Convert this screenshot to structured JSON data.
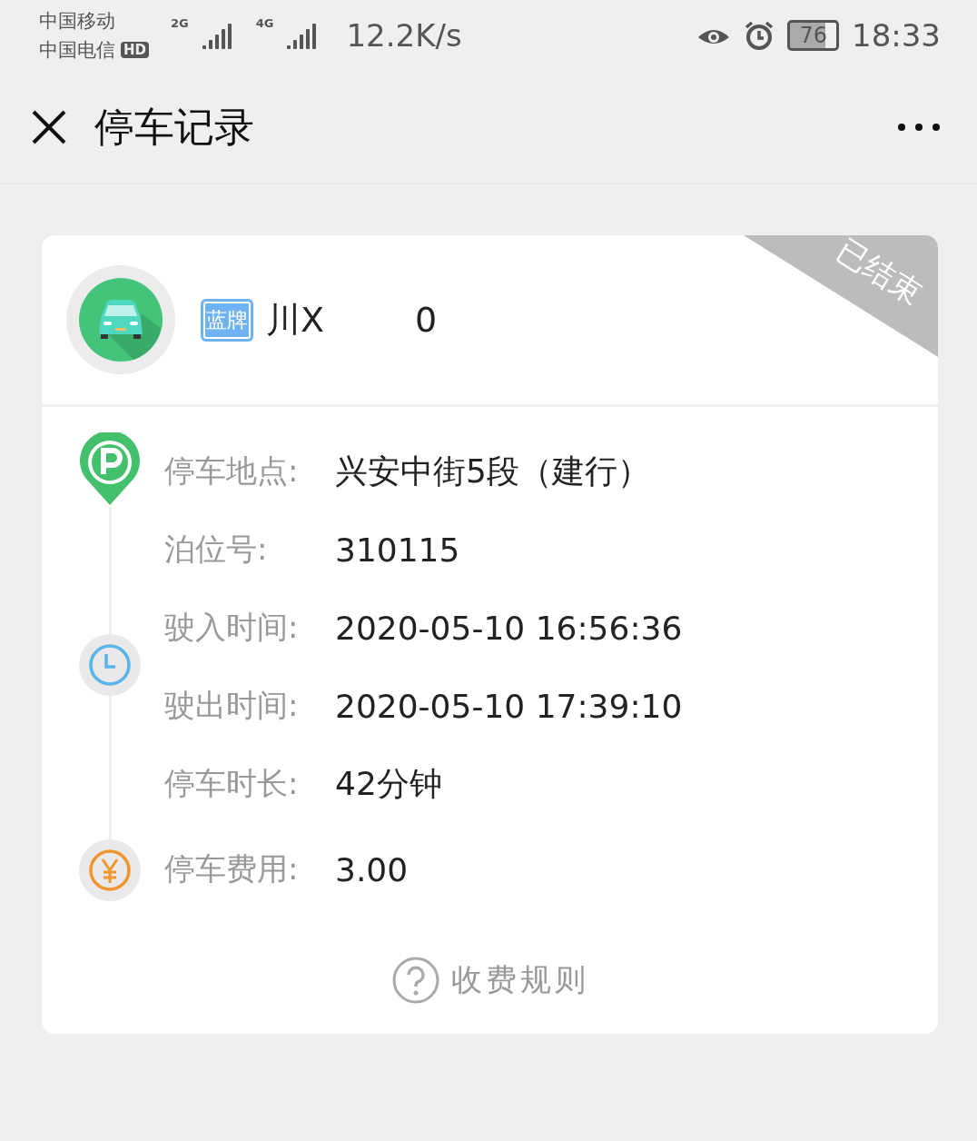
{
  "status_bar": {
    "carrier_1": "中国移动",
    "carrier_2": "中国电信",
    "hd_badge": "HD",
    "net_1": "2G",
    "net_2": "4G",
    "speed": "12.2K/s",
    "battery": "76",
    "time": "18:33"
  },
  "header": {
    "title": "停车记录"
  },
  "card": {
    "plate_type": "蓝牌",
    "plate_start": "川X",
    "plate_end": "0",
    "status": "已结束",
    "rows": [
      {
        "label": "停车地点:",
        "value": "兴安中街5段（建行）"
      },
      {
        "label": "泊位号:",
        "value": "310115"
      },
      {
        "label": "驶入时间:",
        "value": "2020-05-10 16:56:36"
      },
      {
        "label": "驶出时间:",
        "value": "2020-05-10 17:39:10"
      },
      {
        "label": "停车时长:",
        "value": "42分钟"
      },
      {
        "label": "停车费用:",
        "value": "3.00"
      }
    ],
    "rules_link": "收费规则"
  }
}
